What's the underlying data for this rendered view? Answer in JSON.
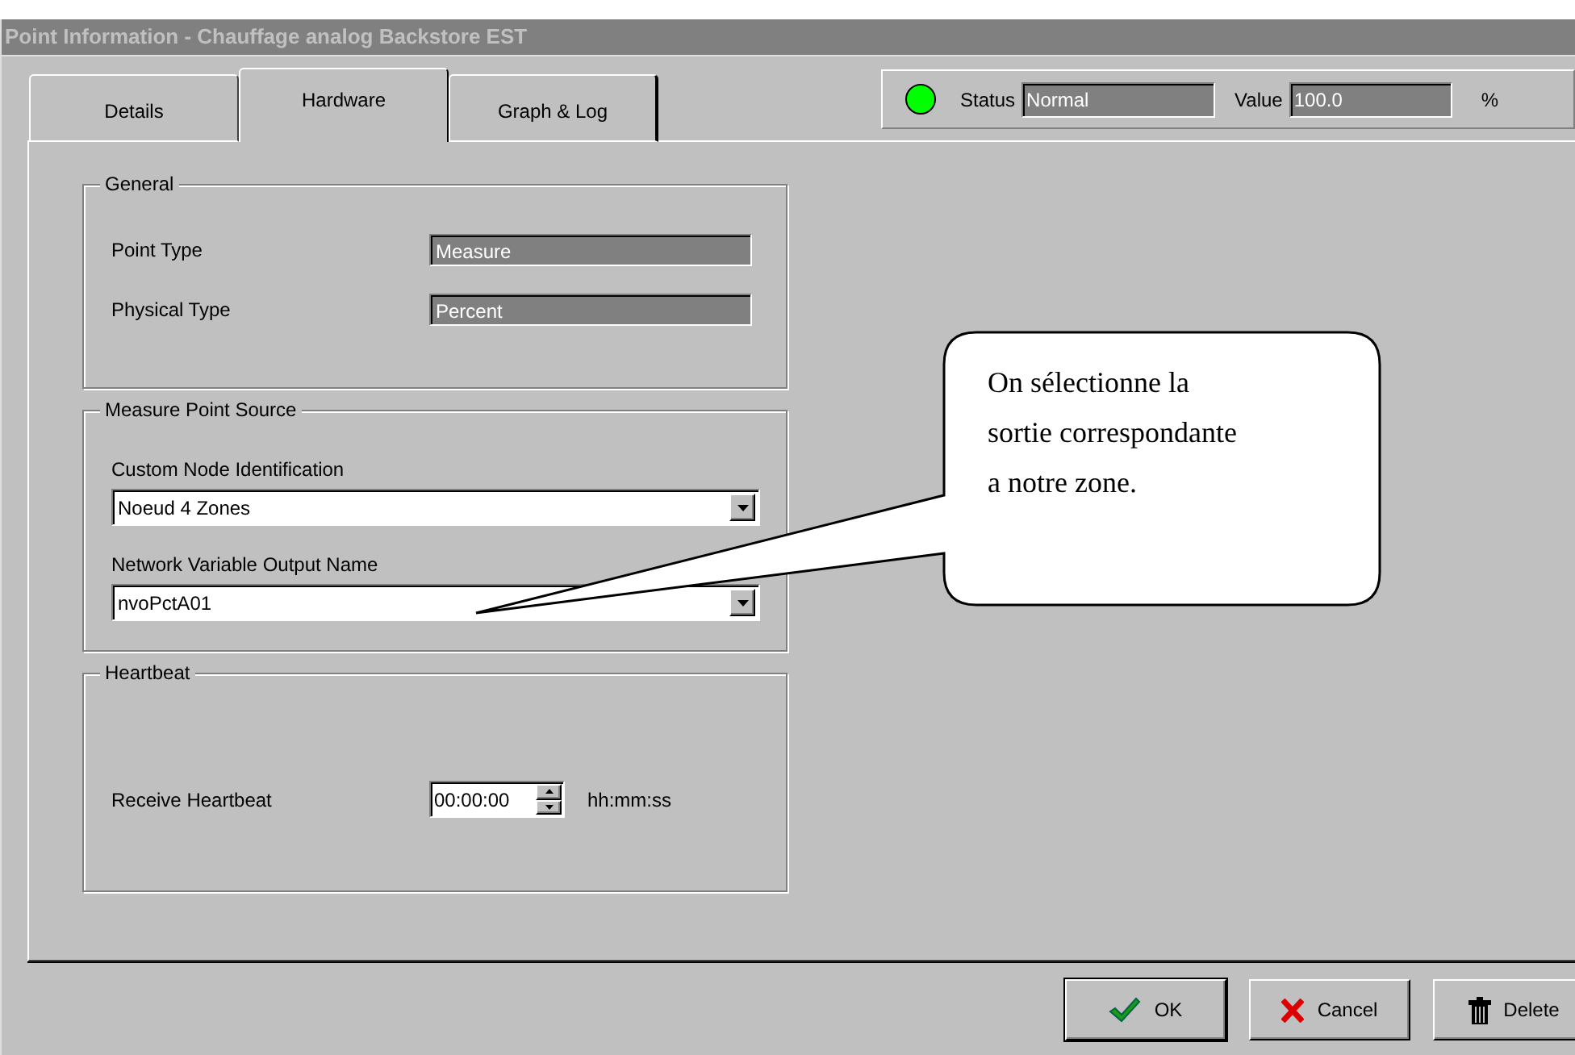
{
  "window": {
    "title": "Point Information - Chauffage analog Backstore EST"
  },
  "tabs": [
    {
      "label": "Details",
      "selected": false
    },
    {
      "label": "Hardware",
      "selected": true
    },
    {
      "label": "Graph & Log",
      "selected": false
    }
  ],
  "status": {
    "label": "Status",
    "value": "Normal",
    "value_label": "Value",
    "reading": "100.0",
    "unit": "%"
  },
  "groups": [
    {
      "title": "General",
      "rows": [
        {
          "kind": "readonly",
          "label": "Point Type",
          "value": "Measure"
        },
        {
          "kind": "readonly",
          "label": "Physical Type",
          "value": "Percent"
        }
      ]
    },
    {
      "title": "Measure Point Source",
      "rows": [
        {
          "kind": "combo",
          "label": "Custom Node Identification",
          "value": "Noeud 4 Zones"
        },
        {
          "kind": "combo",
          "label": "Network Variable Output Name",
          "value": "nvoPctA01"
        }
      ]
    },
    {
      "title": "Heartbeat",
      "rows": [
        {
          "kind": "spin",
          "label": "Receive Heartbeat",
          "value": "00:00:00",
          "unit": "hh:mm:ss"
        }
      ]
    }
  ],
  "callout": {
    "text": "On sélectionne la sortie correspondante a notre zone."
  },
  "buttons": [
    {
      "kind": "ok",
      "label": "OK",
      "default": true
    },
    {
      "kind": "cancel",
      "label": "Cancel",
      "default": false
    },
    {
      "kind": "delete",
      "label": "Delete",
      "default": false
    }
  ]
}
